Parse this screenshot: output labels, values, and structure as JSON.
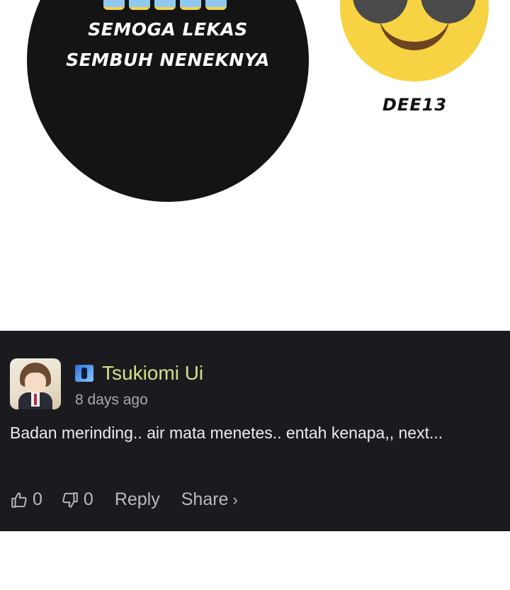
{
  "panel": {
    "bubble_line1": "SEMOGA LEKAS",
    "bubble_line2": "SEMBUH NENEKNYA",
    "author_tag": "DEE13"
  },
  "comment": {
    "user_name": "Tsukiomi Ui",
    "time": "8 days ago",
    "text": "Badan merinding.. air mata menetes.. entah kenapa,, next...",
    "likes": "0",
    "dislikes": "0",
    "reply_label": "Reply",
    "share_label": "Share",
    "share_chevron": "›",
    "name_color": "#cfe28a"
  }
}
